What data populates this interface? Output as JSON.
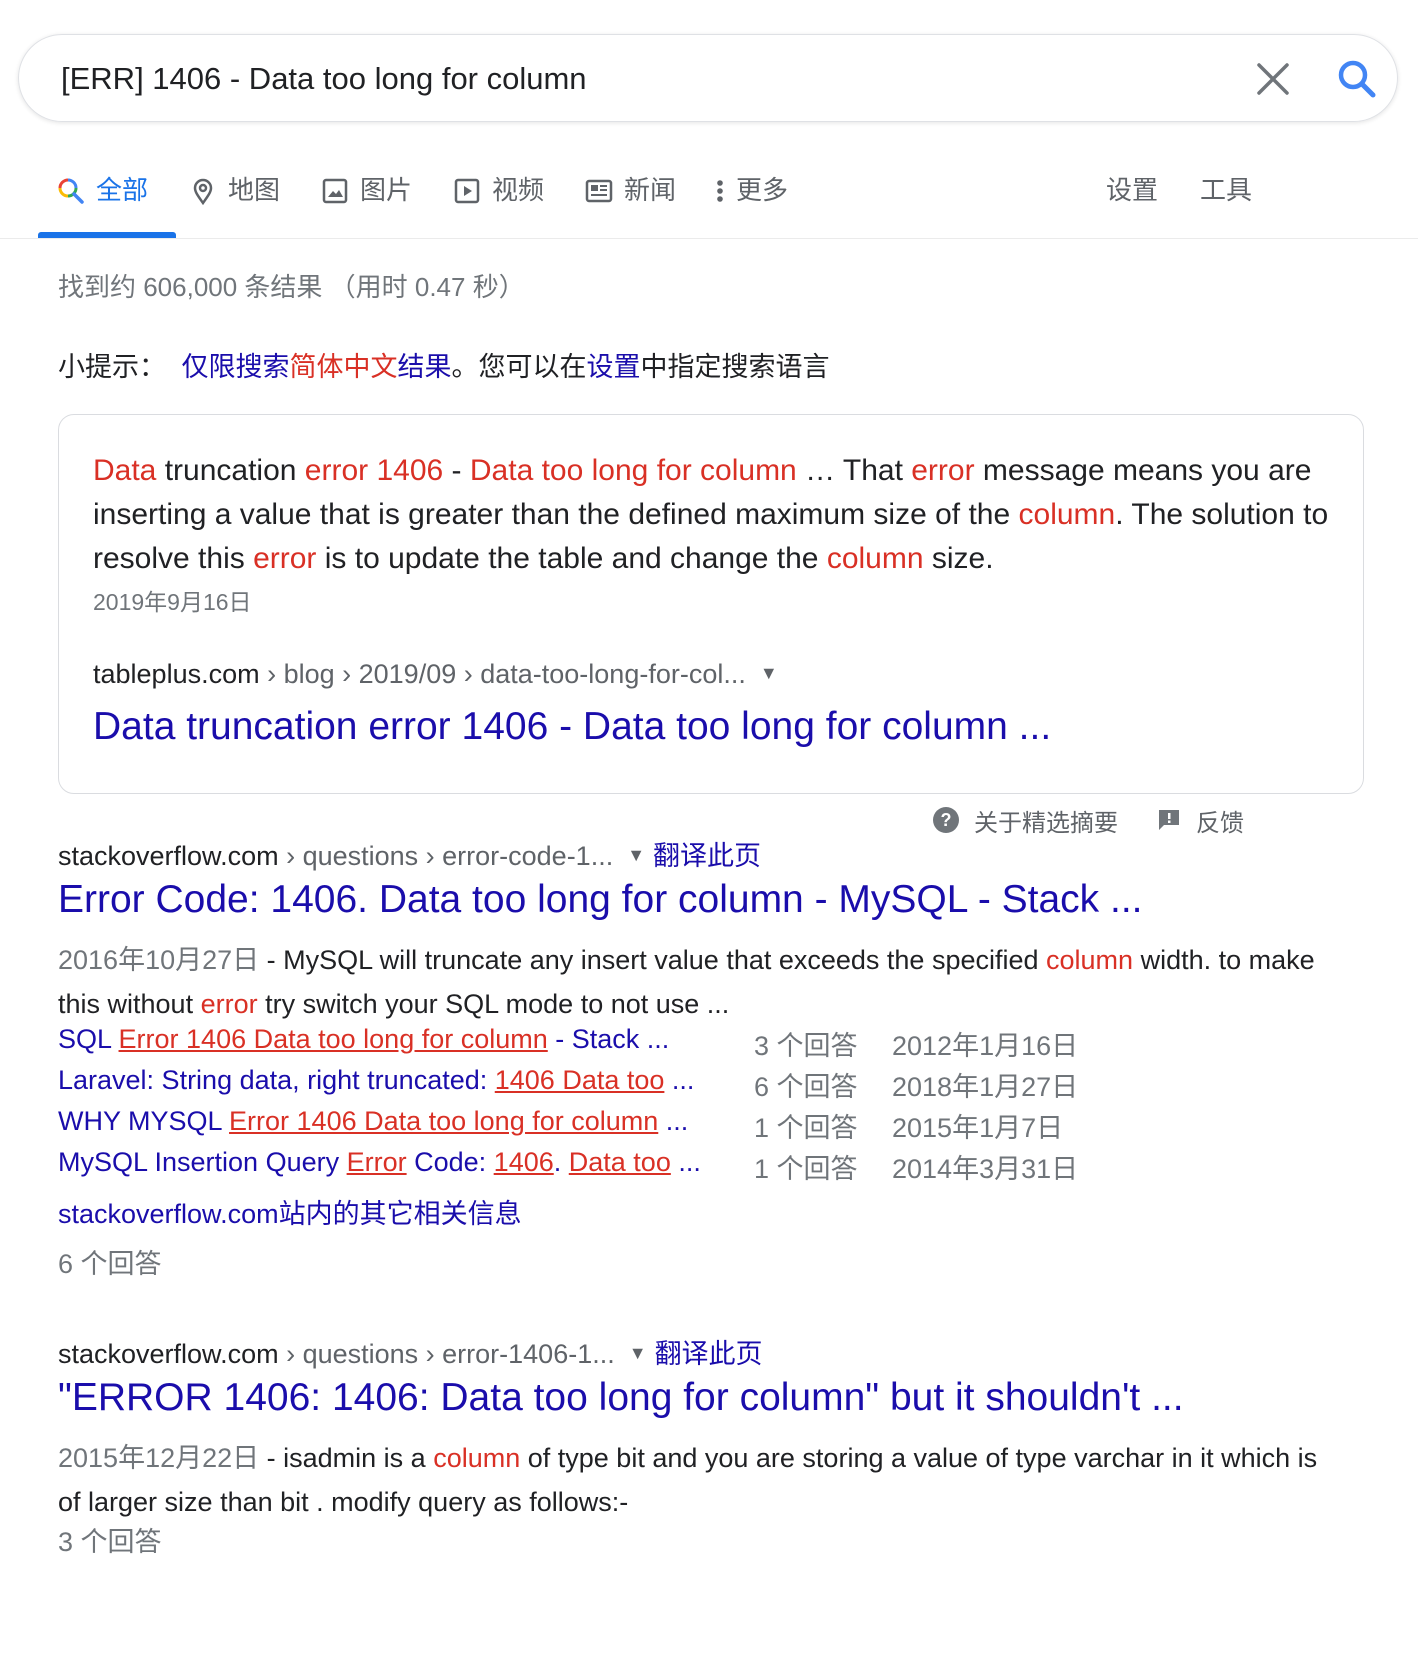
{
  "search": {
    "query": "[ERR] 1406 - Data too long for column"
  },
  "tabs": [
    {
      "label": "全部",
      "icon": "search-multicolor-icon"
    },
    {
      "label": "地图",
      "icon": "map-pin-icon"
    },
    {
      "label": "图片",
      "icon": "image-icon"
    },
    {
      "label": "视频",
      "icon": "video-play-icon"
    },
    {
      "label": "新闻",
      "icon": "news-icon"
    },
    {
      "label": "更多",
      "icon": "more-vert-icon"
    }
  ],
  "tools": {
    "settings": "设置",
    "tools": "工具"
  },
  "stats": "找到约 606,000 条结果 （用时 0.47 秒）",
  "tip": {
    "prefix": "小提示：",
    "link1": "仅限搜索",
    "highlight": "简体中文",
    "link2": "结果",
    "text1": "。您可以在",
    "settings_link": "设置",
    "text2": "中指定搜索语言"
  },
  "featured": {
    "snippet": [
      {
        "t": "Data",
        "em": true
      },
      {
        "t": " truncation ",
        "em": false
      },
      {
        "t": "error 1406",
        "em": true
      },
      {
        "t": " - ",
        "em": false
      },
      {
        "t": "Data too long for column",
        "em": true
      },
      {
        "t": " … That ",
        "em": false
      },
      {
        "t": "error",
        "em": true
      },
      {
        "t": " message means you are inserting a value that is greater than the defined maximum size of the ",
        "em": false
      },
      {
        "t": "column",
        "em": true
      },
      {
        "t": ". The solution to resolve this ",
        "em": false
      },
      {
        "t": "error",
        "em": true
      },
      {
        "t": " is to update the table and change the ",
        "em": false
      },
      {
        "t": "column",
        "em": true
      },
      {
        "t": " size.",
        "em": false
      }
    ],
    "date": "2019年9月16日",
    "site": "tableplus.com",
    "path": " › blog › 2019/09 › data-too-long-for-col...",
    "title": "Data truncation error 1406 - Data too long for column ...",
    "about_label": "关于精选摘要",
    "feedback_label": "反馈"
  },
  "results": [
    {
      "site": "stackoverflow.com",
      "path": " › questions › error-code-1...",
      "translate": "翻译此页",
      "title": "Error Code: 1406. Data too long for column - MySQL - Stack ...",
      "date": "2016年10月27日",
      "snippet": [
        {
          "t": " - MySQL will truncate any insert value that exceeds the specified ",
          "em": false
        },
        {
          "t": "column",
          "em": true
        },
        {
          "t": " width. to make this without ",
          "em": false
        },
        {
          "t": "error",
          "em": true
        },
        {
          "t": " try switch your SQL mode to not use ...",
          "em": false
        }
      ],
      "sublinks": [
        {
          "parts": [
            {
              "t": "SQL ",
              "u": false
            },
            {
              "t": "Error 1406 Data too long for column",
              "u": true
            },
            {
              "t": " - Stack ...",
              "u": false
            }
          ],
          "answers": "3 个回答",
          "date": "2012年1月16日"
        },
        {
          "parts": [
            {
              "t": "Laravel: String data, right truncated: ",
              "u": false
            },
            {
              "t": "1406 Data too",
              "u": true
            },
            {
              "t": " ...",
              "u": false
            }
          ],
          "answers": "6 个回答",
          "date": "2018年1月27日"
        },
        {
          "parts": [
            {
              "t": "WHY MYSQL ",
              "u": false
            },
            {
              "t": "Error 1406 Data too long for column",
              "u": true
            },
            {
              "t": " ...",
              "u": false
            }
          ],
          "answers": "1 个回答",
          "date": "2015年1月7日"
        },
        {
          "parts": [
            {
              "t": "MySQL Insertion Query ",
              "u": false
            },
            {
              "t": "Error",
              "u": true
            },
            {
              "t": " Code: ",
              "u": false
            },
            {
              "t": "1406",
              "u": true
            },
            {
              "t": ". ",
              "u": false
            },
            {
              "t": "Data too",
              "u": true
            },
            {
              "t": " ...",
              "u": false
            }
          ],
          "answers": "1 个回答",
          "date": "2014年3月31日"
        }
      ],
      "more": "stackoverflow.com站内的其它相关信息",
      "answers": "6 个回答"
    },
    {
      "site": "stackoverflow.com",
      "path": " › questions › error-1406-1...",
      "translate": "翻译此页",
      "title": "\"ERROR 1406: 1406: Data too long for column\" but it shouldn't ...",
      "date": "2015年12月22日",
      "snippet": [
        {
          "t": " - isadmin is a ",
          "em": false
        },
        {
          "t": "column",
          "em": true
        },
        {
          "t": " of type bit and you are storing a value of type varchar in it which is of larger size than bit . modify query as follows:-",
          "em": false
        }
      ],
      "answers": "3 个回答"
    }
  ],
  "colors": {
    "link": "#1a0dab",
    "accent": "#1a73e8",
    "highlight": "#d93025",
    "muted": "#70757a"
  }
}
